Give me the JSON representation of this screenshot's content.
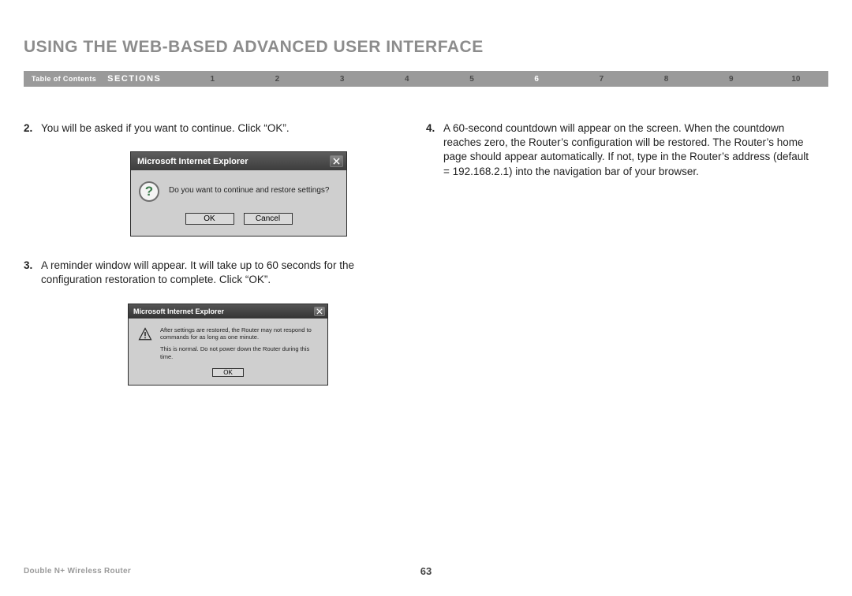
{
  "heading": "USING THE WEB-BASED ADVANCED USER INTERFACE",
  "nav": {
    "toc": "Table of Contents",
    "sections_label": "SECTIONS",
    "items": [
      "1",
      "2",
      "3",
      "4",
      "5",
      "6",
      "7",
      "8",
      "9",
      "10"
    ],
    "active_index": 5
  },
  "steps": {
    "s2_num": "2.",
    "s2_text": "You will be asked if you want to continue. Click “OK”.",
    "s3_num": "3.",
    "s3_text": "A reminder window will appear. It will take up to 60 seconds for the configuration restoration to complete. Click “OK”.",
    "s4_num": "4.",
    "s4_text": "A 60-second countdown will appear on the screen. When the countdown reaches zero, the Router’s configuration will be restored. The Router’s home page should appear automatically. If not, type in the Router’s address (default = 192.168.2.1) into the navigation bar of your browser."
  },
  "dialog1": {
    "title": "Microsoft Internet Explorer",
    "message": "Do you want to continue and restore settings?",
    "ok": "OK",
    "cancel": "Cancel"
  },
  "dialog2": {
    "title": "Microsoft Internet Explorer",
    "line1": "After settings are restored, the Router may not respond to commands for as long as one minute.",
    "line2": "This is normal. Do not power down the Router during this time.",
    "ok": "OK"
  },
  "footer": {
    "product": "Double N+ Wireless Router",
    "page": "63"
  }
}
